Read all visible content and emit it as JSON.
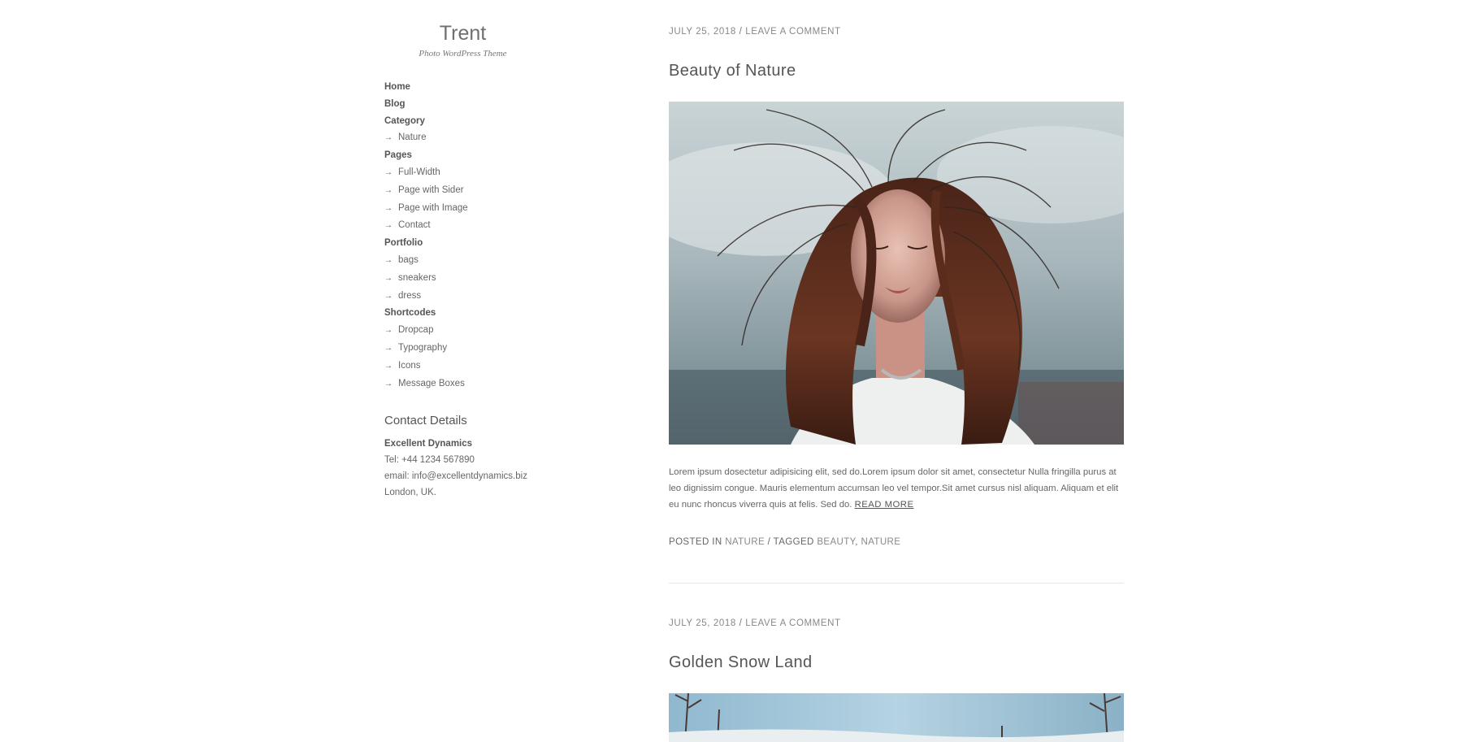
{
  "site": {
    "title": "Trent",
    "tagline": "Photo WordPress Theme"
  },
  "menu": [
    {
      "label": "Home",
      "level": "top"
    },
    {
      "label": "Blog",
      "level": "top"
    },
    {
      "label": "Category",
      "level": "top"
    },
    {
      "label": "Nature",
      "level": "sub"
    },
    {
      "label": "Pages",
      "level": "top"
    },
    {
      "label": "Full-Width",
      "level": "sub"
    },
    {
      "label": "Page with Sider",
      "level": "sub"
    },
    {
      "label": "Page with Image",
      "level": "sub"
    },
    {
      "label": "Contact",
      "level": "sub"
    },
    {
      "label": "Portfolio",
      "level": "top"
    },
    {
      "label": "bags",
      "level": "sub"
    },
    {
      "label": "sneakers",
      "level": "sub"
    },
    {
      "label": "dress",
      "level": "sub"
    },
    {
      "label": "Shortcodes",
      "level": "top"
    },
    {
      "label": "Dropcap",
      "level": "sub"
    },
    {
      "label": "Typography",
      "level": "sub"
    },
    {
      "label": "Icons",
      "level": "sub"
    },
    {
      "label": "Message Boxes",
      "level": "sub"
    }
  ],
  "submenu_arrow": "→",
  "contact": {
    "heading": "Contact Details",
    "company": "Excellent Dynamics",
    "tel": "Tel: +44 1234 567890",
    "email": "email: info@excellentdynamics.biz",
    "location": "London, UK."
  },
  "posts": [
    {
      "date": "JULY 25, 2018",
      "separator": "/",
      "comment_link": "LEAVE A COMMENT",
      "title": "Beauty of Nature",
      "image_icon": "portrait-photo",
      "excerpt": "Lorem ipsum dosectetur adipisicing elit, sed do.Lorem ipsum dolor sit amet, consectetur Nulla fringilla purus at leo dignissim congue. Mauris elementum accumsan leo vel tempor.Sit amet cursus nisl aliquam. Aliquam et elit eu nunc rhoncus viverra quis at felis. Sed do.",
      "read_more": "READ MORE",
      "posted_in_label": "POSTED IN",
      "category": "NATURE",
      "tagged_label": "/ TAGGED",
      "tags": [
        "BEAUTY",
        "NATURE"
      ],
      "tag_separator": ", "
    },
    {
      "date": "JULY 25, 2018",
      "separator": "/",
      "comment_link": "LEAVE A COMMENT",
      "title": "Golden Snow Land",
      "image_icon": "landscape-photo"
    }
  ],
  "colors": {
    "text": "#555555",
    "meta": "#888888",
    "divider": "#e6e6e6"
  }
}
